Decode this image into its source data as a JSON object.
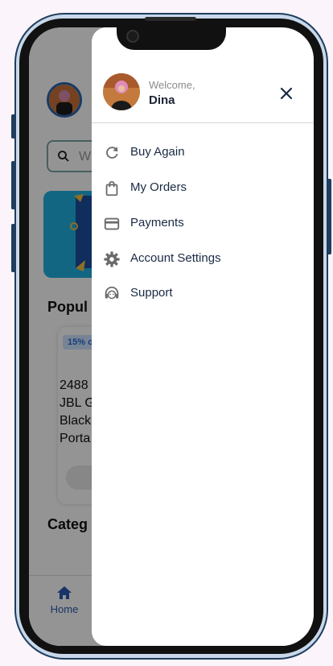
{
  "app": {
    "search_placeholder": "W",
    "popular_title": "Popul",
    "product": {
      "discount": "15% o",
      "lines": [
        "2488",
        "JBL G",
        "Black",
        "Porta"
      ]
    },
    "categories_title": "Categ",
    "tabbar": {
      "home_label": "Home"
    }
  },
  "drawer": {
    "welcome": "Welcome,",
    "username": "Dina",
    "items": [
      {
        "label": "Buy Again",
        "icon": "refresh-icon"
      },
      {
        "label": "My Orders",
        "icon": "shopping-bag-icon"
      },
      {
        "label": "Payments",
        "icon": "credit-card-icon"
      },
      {
        "label": "Account Settings",
        "icon": "gear-icon"
      },
      {
        "label": "Support",
        "icon": "support-agent-icon"
      }
    ]
  },
  "colors": {
    "accent": "#2a64b0",
    "menu_text": "#1a2a44",
    "icon_gray": "#6b6b6b",
    "frame": "#1f3d5c"
  }
}
